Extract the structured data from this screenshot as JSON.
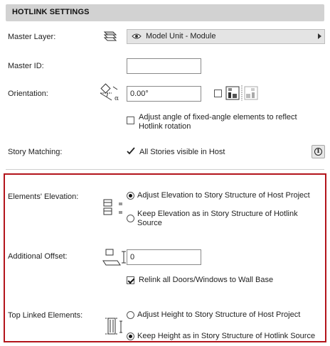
{
  "header": {
    "title": "HOTLINK SETTINGS"
  },
  "master_layer": {
    "label": "Master Layer:",
    "value": "Model Unit - Module"
  },
  "master_id": {
    "label": "Master ID:",
    "value": ""
  },
  "orientation": {
    "label": "Orientation:",
    "value": "0.00°",
    "adjust_angle_label": "Adjust angle of fixed-angle elements to reflect Hotlink rotation",
    "adjust_angle_checked": false
  },
  "story_matching": {
    "label": "Story Matching:",
    "status": "All Stories visible in Host"
  },
  "elements_elevation": {
    "label": "Elements' Elevation:",
    "options": [
      "Adjust Elevation to Story Structure of Host Project",
      "Keep Elevation as in Story Structure of Hotlink Source"
    ],
    "selected_index": 0
  },
  "additional_offset": {
    "label": "Additional Offset:",
    "value": "0",
    "relink_label": "Relink all Doors/Windows to Wall Base",
    "relink_checked": true
  },
  "top_linked": {
    "label": "Top Linked Elements:",
    "options": [
      "Adjust Height to Story Structure of Host Project",
      "Keep Height as in Story Structure of Hotlink Source"
    ],
    "selected_index": 1
  },
  "colors": {
    "highlight_border": "#b3141b",
    "header_bg": "#d2d2d2"
  }
}
